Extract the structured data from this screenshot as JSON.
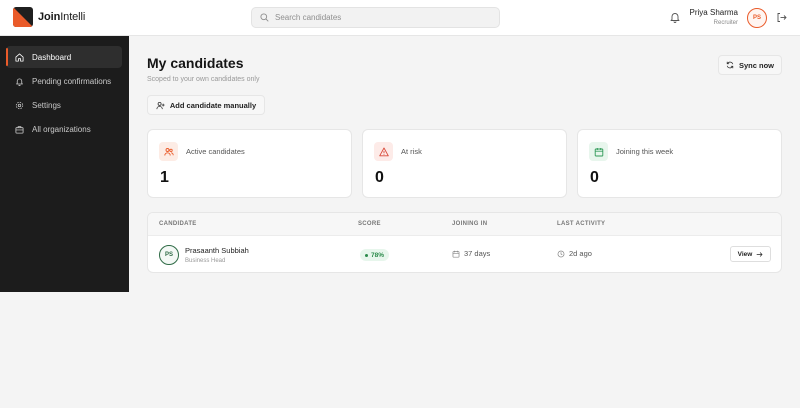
{
  "app": {
    "brand_bold": "Join",
    "brand_light": "Intelli"
  },
  "search": {
    "placeholder": "Search candidates"
  },
  "user": {
    "name": "Priya Sharma",
    "role": "Recruiter",
    "initials": "PS"
  },
  "sidebar": {
    "items": [
      {
        "label": "Dashboard",
        "icon": "home-icon",
        "active": true
      },
      {
        "label": "Pending confirmations",
        "icon": "bell-icon",
        "active": false
      },
      {
        "label": "Settings",
        "icon": "gear-icon",
        "active": false
      },
      {
        "label": "All organizations",
        "icon": "briefcase-icon",
        "active": false
      }
    ]
  },
  "header": {
    "title": "My candidates",
    "subtitle": "Scoped to your own candidates only",
    "sync_label": "Sync now",
    "add_label": "Add candidate manually"
  },
  "stats": [
    {
      "label": "Active candidates",
      "value": "1",
      "icon": "users-icon",
      "color": "#ea5b2a",
      "bg": "#fdece5"
    },
    {
      "label": "At risk",
      "value": "0",
      "icon": "warning-icon",
      "color": "#d94a3a",
      "bg": "#fdebe8"
    },
    {
      "label": "Joining this week",
      "value": "0",
      "icon": "calendar-icon",
      "color": "#2f9a58",
      "bg": "#e8f6ed"
    }
  ],
  "table": {
    "columns": [
      "CANDIDATE",
      "SCORE",
      "JOINING IN",
      "LAST ACTIVITY"
    ],
    "rows": [
      {
        "initials": "PS",
        "name": "Prasaanth Subbiah",
        "role": "Business Head",
        "score": "78%",
        "joining": "37 days",
        "activity": "2d ago",
        "action": "View"
      }
    ]
  }
}
